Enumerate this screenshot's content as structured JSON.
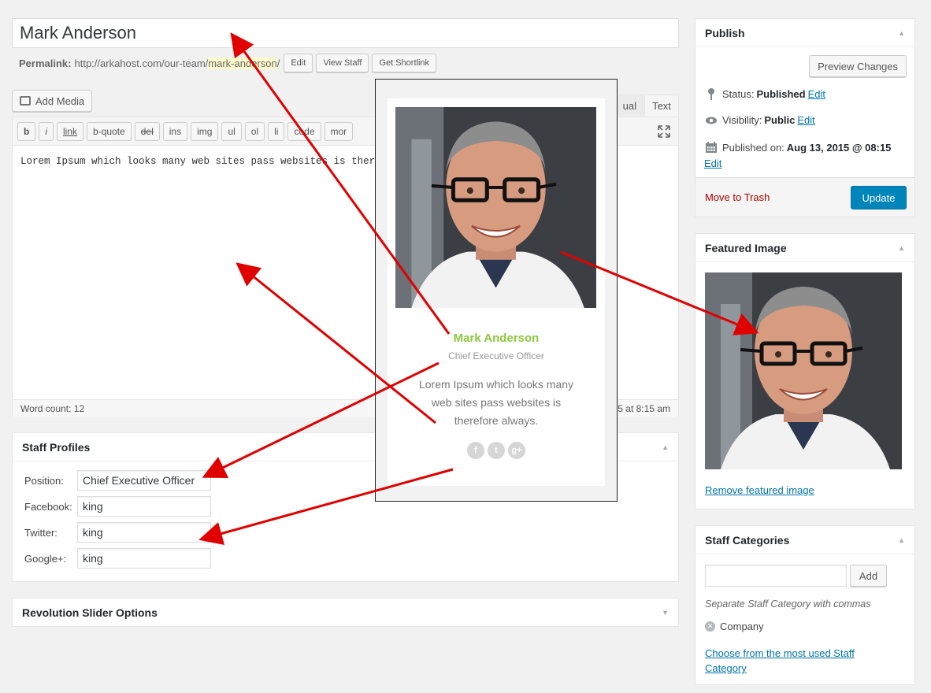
{
  "post": {
    "title": "Mark Anderson",
    "permalink_label": "Permalink:",
    "permalink_base": "http://arkahost.com/our-team/",
    "permalink_slug": "mark-anderson",
    "permalink_end": "/",
    "edit_btn": "Edit",
    "view_btn": "View Staff",
    "shortlink_btn": "Get Shortlink"
  },
  "editor": {
    "add_media": "Add Media",
    "tab_visual": "Visual",
    "tab_visual_visible": "ual",
    "tab_text": "Text",
    "quicktags": [
      "b",
      "i",
      "link",
      "b-quote",
      "del",
      "ins",
      "img",
      "ul",
      "ol",
      "li",
      "code",
      "more"
    ],
    "quicktags_visible": [
      "b",
      "i",
      "link",
      "b-quote",
      "del",
      "ins",
      "img",
      "ul",
      "ol",
      "li",
      "code",
      "mor"
    ],
    "content": "Lorem Ipsum which looks many web sites pass websites is therefo",
    "word_count": "Word count: 12",
    "last_edited_visible": "5 at 8:15 am"
  },
  "staff_profiles": {
    "title": "Staff Profiles",
    "fields": [
      {
        "label": "Position:",
        "value": "Chief Executive Officer"
      },
      {
        "label": "Facebook:",
        "value": "king"
      },
      {
        "label": "Twitter:",
        "value": "king"
      },
      {
        "label": "Google+:",
        "value": "king"
      }
    ]
  },
  "revslider": {
    "title": "Revolution Slider Options"
  },
  "publish": {
    "title": "Publish",
    "preview_btn": "Preview Changes",
    "status_label": "Status:",
    "status_value": "Published",
    "visibility_label": "Visibility:",
    "visibility_value": "Public",
    "published_label": "Published on:",
    "published_value": "Aug 13, 2015 @ 08:15",
    "edit_link": "Edit",
    "trash": "Move to Trash",
    "update_btn": "Update"
  },
  "featured_image": {
    "title": "Featured Image",
    "remove_link": "Remove featured image"
  },
  "staff_categories": {
    "title": "Staff Categories",
    "add_btn": "Add",
    "hint": "Separate Staff Category with commas",
    "tag": "Company",
    "choose_link": "Choose from the most used Staff Category"
  },
  "preview_card": {
    "name": "Mark Anderson",
    "position": "Chief Executive Officer",
    "bio": "Lorem Ipsum which looks many web sites pass websites is therefore always.",
    "social": [
      "f",
      "t",
      "g+"
    ]
  },
  "colors": {
    "accent_green": "#8dc63f",
    "wp_blue": "#0085ba",
    "link_blue": "#0073aa",
    "trash_red": "#a00",
    "arrow_red": "#e00000"
  }
}
